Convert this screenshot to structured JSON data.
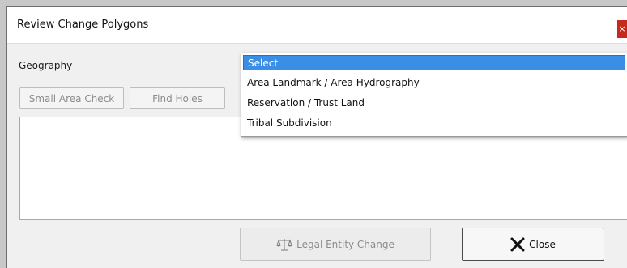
{
  "window": {
    "title": "Review Change Polygons",
    "close_glyph": "×"
  },
  "form": {
    "geography_label": "Geography"
  },
  "geography_dropdown": {
    "options": [
      "Select",
      "Area Landmark / Area Hydrography",
      "Reservation / Trust Land",
      "Tribal Subdivision"
    ],
    "selected_index": 0
  },
  "buttons": {
    "small_area_check": "Small Area Check",
    "find_holes": "Find Holes",
    "legal_entity_change": "Legal Entity Change",
    "close": "Close"
  },
  "icons": {
    "legal_entity_change": "scales-icon",
    "close": "x-mark-icon"
  },
  "colors": {
    "selected_option": "#3a8ee6",
    "title_close": "#c42b1c"
  }
}
